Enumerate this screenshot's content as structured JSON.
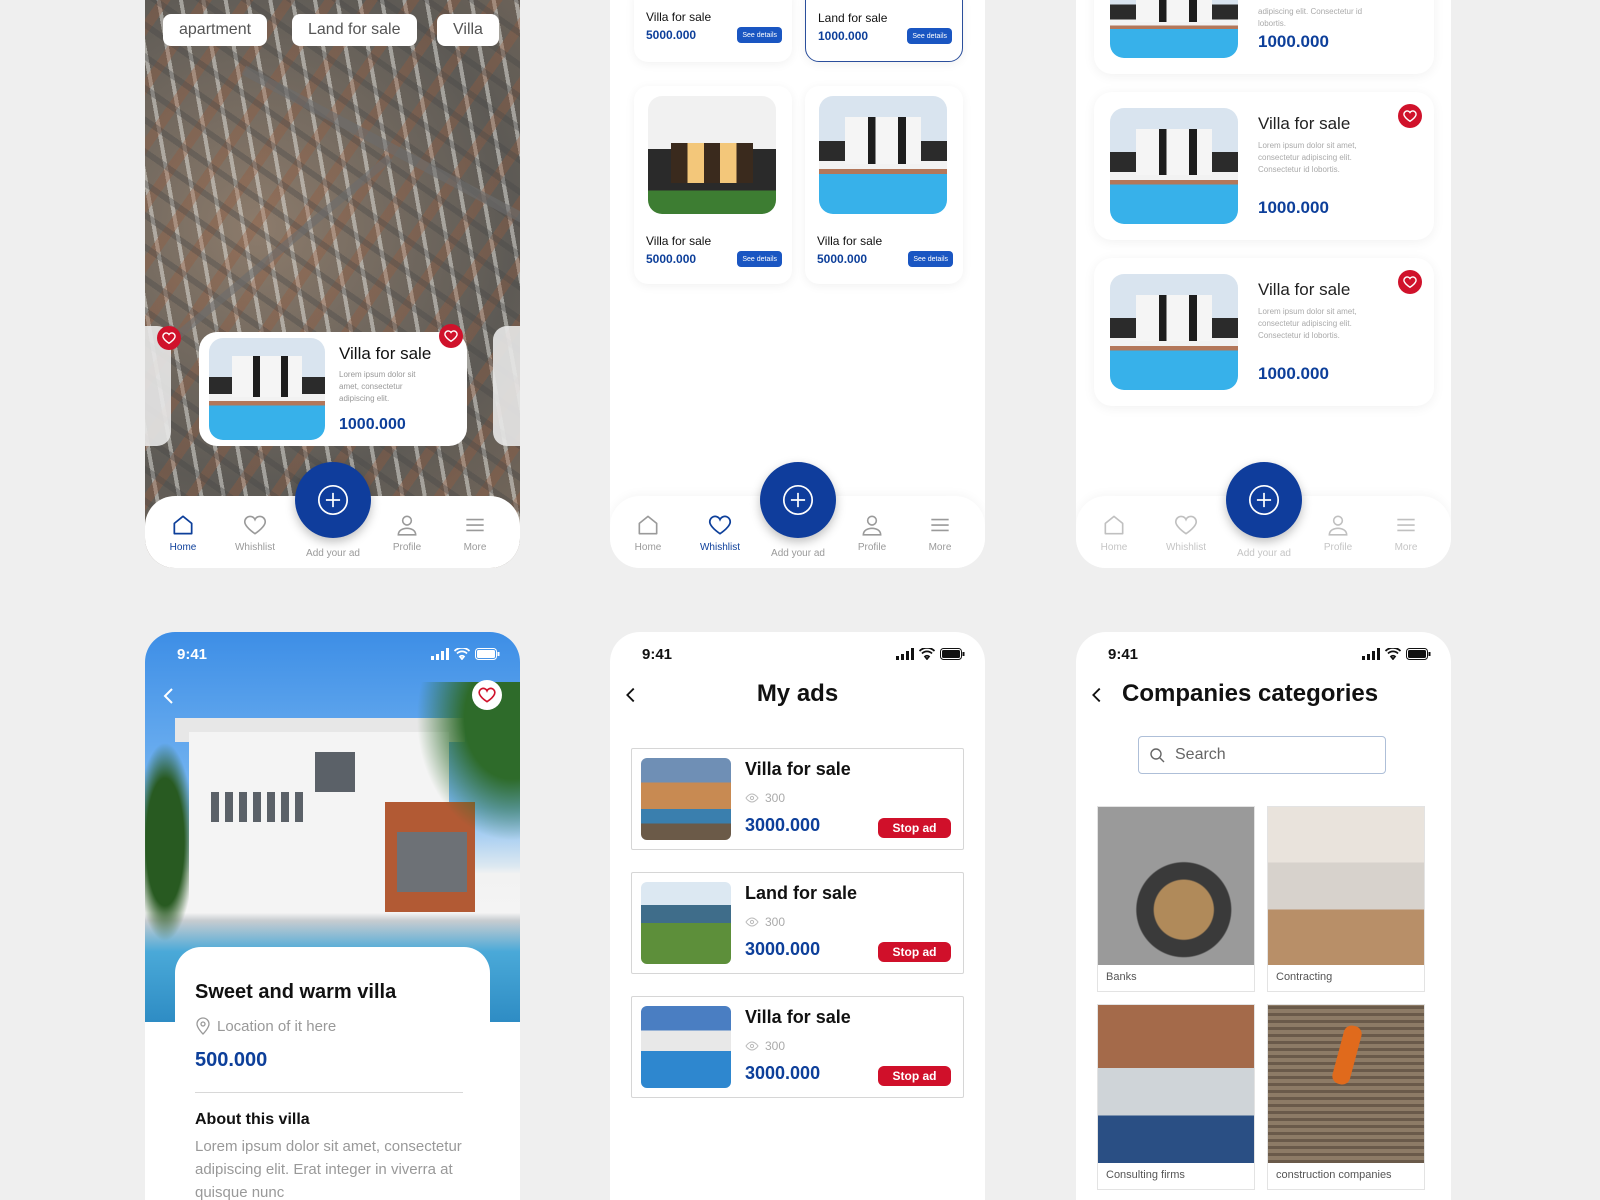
{
  "map_screen": {
    "chips": [
      "apartment",
      "Land for sale",
      "Villa"
    ],
    "card": {
      "title": "Villa for sale",
      "description": "Lorem ipsum dolor sit amet, consectetur adipiscing elit.",
      "price": "1000.000"
    }
  },
  "nav": {
    "home": "Home",
    "wishlist": "Whishlist",
    "add": "Add your ad",
    "profile": "Profile",
    "more": "More"
  },
  "grid_screen": {
    "see_details": "See details",
    "cards": [
      {
        "title": "Villa for sale",
        "price": "5000.000"
      },
      {
        "title": "Land for sale",
        "price": "1000.000"
      },
      {
        "title": "Villa for sale",
        "price": "5000.000"
      },
      {
        "title": "Villa for sale",
        "price": "5000.000"
      }
    ]
  },
  "list_screen": {
    "top_card": {
      "description": "adipiscing elit. Consectetur id lobortis.",
      "price": "1000.000"
    },
    "cards": [
      {
        "title": "Villa for sale",
        "description": "Lorem ipsum dolor sit amet, consectetur adipiscing elit. Consectetur id lobortis.",
        "price": "1000.000"
      },
      {
        "title": "Villa for sale",
        "description": "Lorem ipsum dolor sit amet, consectetur adipiscing elit. Consectetur id lobortis.",
        "price": "1000.000"
      }
    ]
  },
  "status_bar": {
    "time": "9:41"
  },
  "detail_screen": {
    "title": "Sweet and warm villa",
    "location": "Location of it here",
    "price": "500.000",
    "about_heading": "About this villa",
    "about_text": "Lorem ipsum dolor sit amet, consectetur adipiscing elit. Erat integer in viverra at quisque nunc"
  },
  "ads_screen": {
    "title": "My ads",
    "stop_label": "Stop ad",
    "ads": [
      {
        "title": "Villa for sale",
        "views": "300",
        "price": "3000.000"
      },
      {
        "title": "Land for sale",
        "views": "300",
        "price": "3000.000"
      },
      {
        "title": "Villa for sale",
        "views": "300",
        "price": "3000.000"
      }
    ]
  },
  "companies_screen": {
    "title": "Companies categories",
    "search_placeholder": "Search",
    "categories": [
      "Banks",
      "Contracting",
      "Consulting firms",
      "construction companies"
    ]
  },
  "colors": {
    "brand_blue": "#0f3d9c",
    "danger_red": "#d0102a",
    "background": "#efefef"
  },
  "icons": [
    "home-icon",
    "heart-icon",
    "plus-circle-icon",
    "user-icon",
    "menu-icon",
    "chevron-left-icon",
    "eye-icon",
    "location-pin-icon",
    "search-icon",
    "signal-icon",
    "wifi-icon",
    "battery-icon"
  ]
}
